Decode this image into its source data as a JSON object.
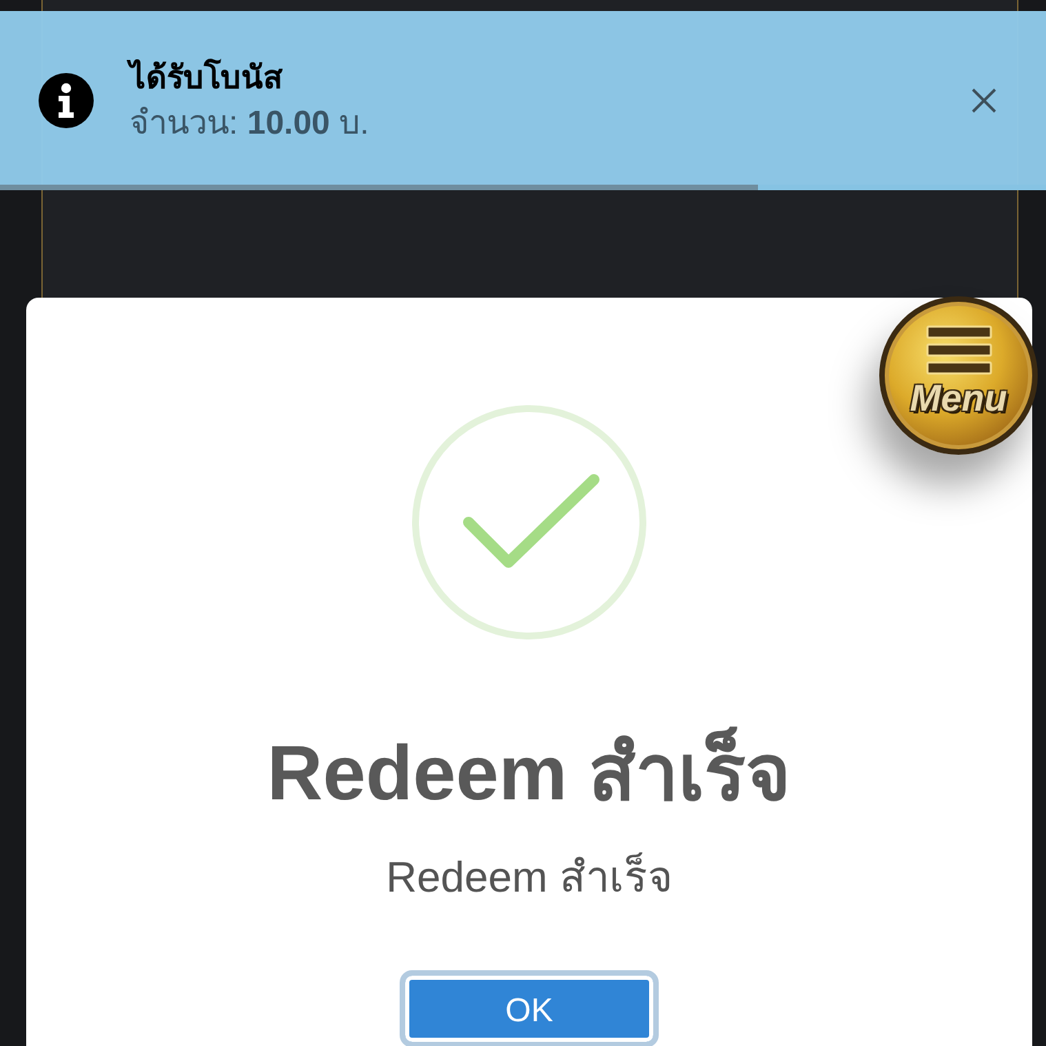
{
  "toast": {
    "kind": "info",
    "title": "ได้รับโบนัส",
    "message": "จำนวน: **10.00** บ.",
    "level": 0.725
  },
  "modal": {
    "kind": "success",
    "title": "Redeem สำเร็จ",
    "text": "Redeem สำเร็จ",
    "buttons": [
      {
        "label": "OK",
        "focused": true
      }
    ]
  },
  "menu_button": {
    "label": "Menu"
  }
}
